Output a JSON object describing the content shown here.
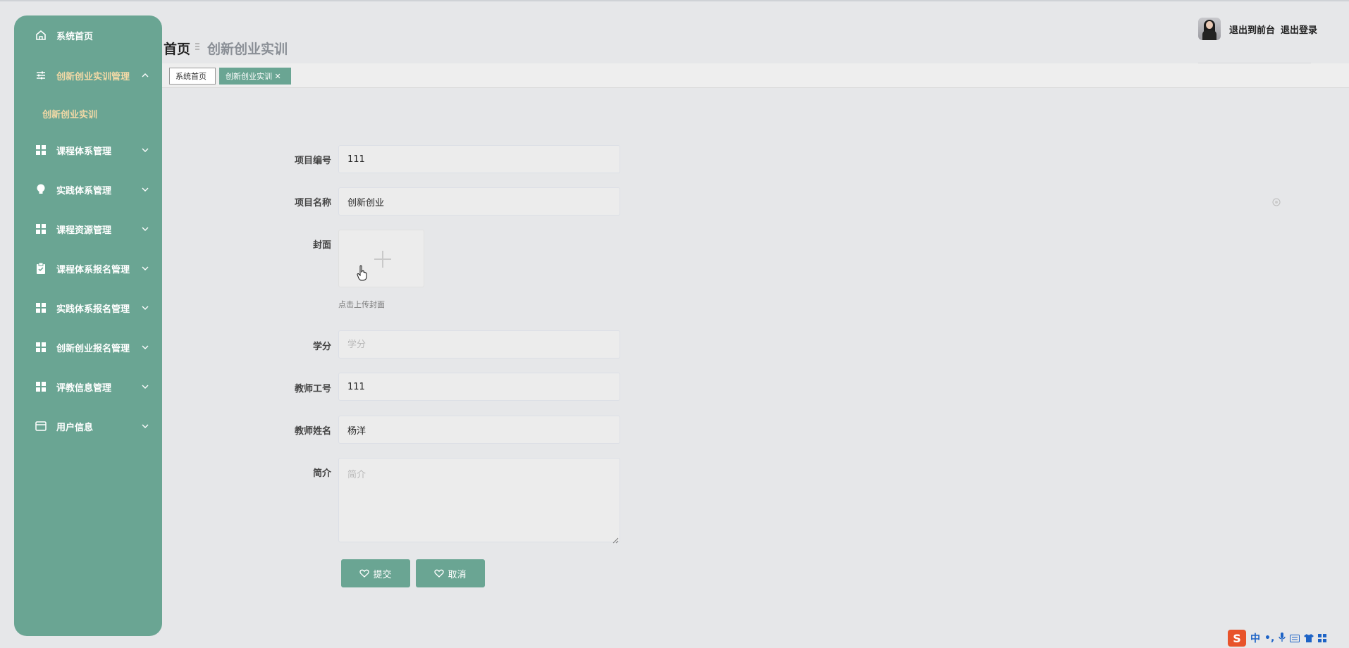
{
  "sidebar": {
    "items": [
      {
        "label": "系统首页",
        "icon": "home-icon"
      },
      {
        "label": "创新创业实训管理",
        "icon": "sliders-icon",
        "expanded": true
      },
      {
        "label": "课程体系管理",
        "icon": "grid-icon"
      },
      {
        "label": "实践体系管理",
        "icon": "bulb-icon"
      },
      {
        "label": "课程资源管理",
        "icon": "grid-icon"
      },
      {
        "label": "课程体系报名管理",
        "icon": "clipboard-icon"
      },
      {
        "label": "实践体系报名管理",
        "icon": "grid-icon"
      },
      {
        "label": "创新创业报名管理",
        "icon": "grid-icon"
      },
      {
        "label": "评教信息管理",
        "icon": "grid-icon"
      },
      {
        "label": "用户信息",
        "icon": "card-icon"
      }
    ],
    "sub_item": "创新创业实训"
  },
  "header": {
    "crumb_home": "首页",
    "crumb_page": "创新创业实训",
    "to_front": "退出到前台",
    "logout": "退出登录"
  },
  "tabs": {
    "home": "系统首页",
    "current": "创新创业实训"
  },
  "form": {
    "project_no": {
      "label": "项目编号",
      "value": "111"
    },
    "project_name": {
      "label": "项目名称",
      "value": "创新创业"
    },
    "cover": {
      "label": "封面",
      "tip": "点击上传封面"
    },
    "credit": {
      "label": "学分",
      "placeholder": "学分"
    },
    "teacher_no": {
      "label": "教师工号",
      "value": "111"
    },
    "teacher_name": {
      "label": "教师姓名",
      "value": "杨洋"
    },
    "intro": {
      "label": "简介",
      "placeholder": "简介"
    },
    "submit": "提交",
    "cancel": "取消"
  },
  "ime": {
    "mode": "中",
    "punct": "•,"
  },
  "colors": {
    "accent": "#6aa593",
    "active_text": "#f3d9a6",
    "background": "#e6e7e9"
  }
}
